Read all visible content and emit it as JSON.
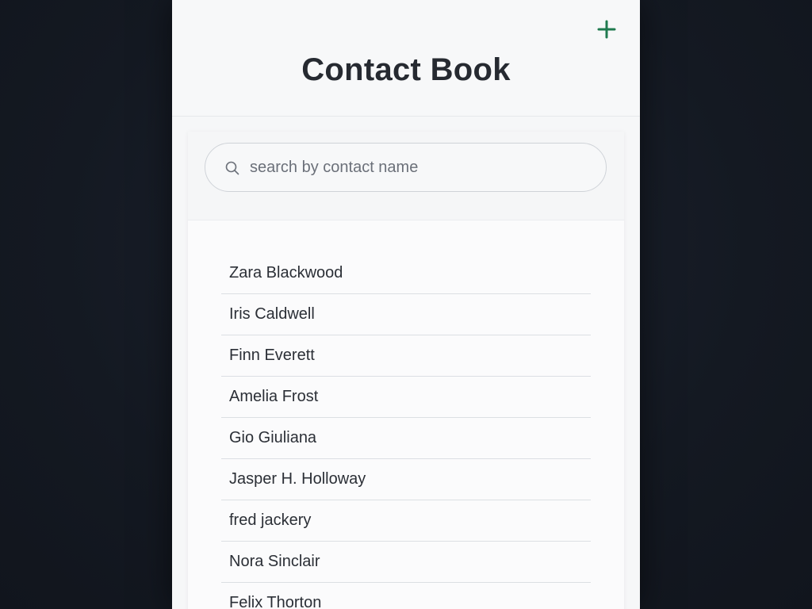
{
  "header": {
    "title": "Contact Book",
    "add_button_icon": "plus-icon",
    "accent_color": "#1f7a4f"
  },
  "search": {
    "placeholder": "search by contact name",
    "value": "",
    "icon": "search-icon"
  },
  "contacts": [
    {
      "name": "Zara Blackwood"
    },
    {
      "name": "Iris Caldwell"
    },
    {
      "name": "Finn Everett"
    },
    {
      "name": "Amelia Frost"
    },
    {
      "name": "Gio Giuliana"
    },
    {
      "name": "Jasper H. Holloway"
    },
    {
      "name": "fred jackery"
    },
    {
      "name": "Nora Sinclair"
    },
    {
      "name": "Felix Thorton"
    }
  ]
}
